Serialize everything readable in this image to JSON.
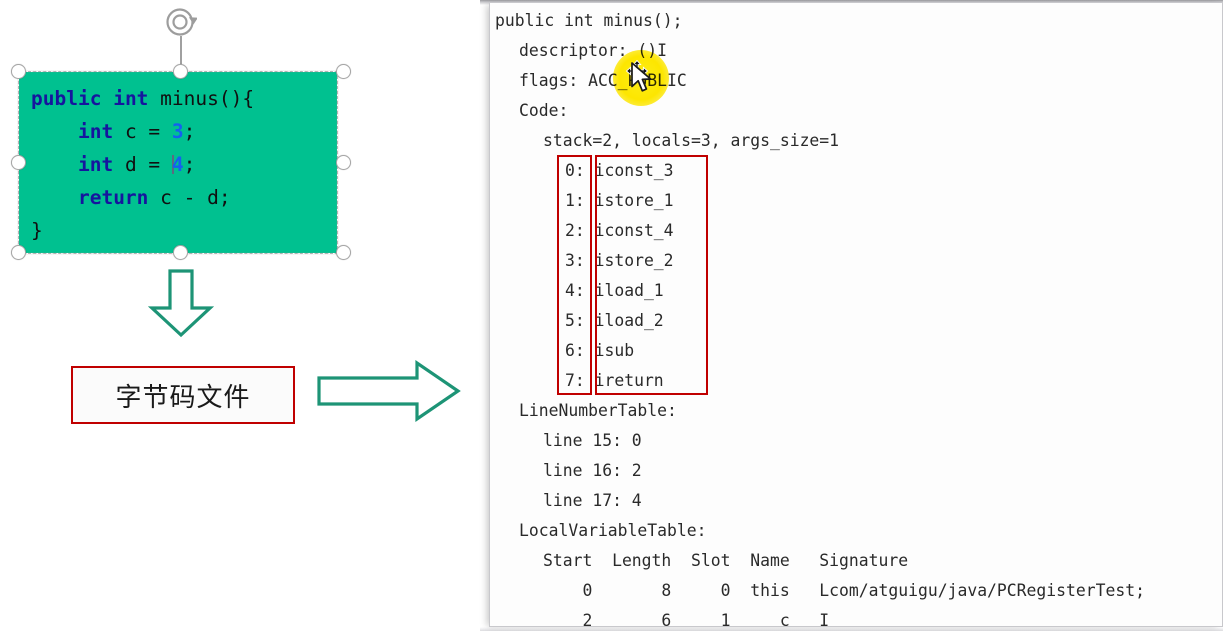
{
  "slide": {
    "code_shape": {
      "name": "java-source-snippet",
      "fill_color": "#00c190",
      "lines": [
        {
          "parts": [
            {
              "t": "public",
              "c": "kw"
            },
            {
              "t": " ",
              "c": "plain"
            },
            {
              "t": "int",
              "c": "kw"
            },
            {
              "t": " minus(){",
              "c": "plain"
            }
          ]
        },
        {
          "parts": [
            {
              "t": "    ",
              "c": "plain"
            },
            {
              "t": "int",
              "c": "kw"
            },
            {
              "t": " c = ",
              "c": "plain"
            },
            {
              "t": "3",
              "c": "num"
            },
            {
              "t": ";",
              "c": "plain"
            }
          ]
        },
        {
          "parts": [
            {
              "t": "    ",
              "c": "plain"
            },
            {
              "t": "int",
              "c": "kw"
            },
            {
              "t": " d = ",
              "c": "plain"
            },
            {
              "t": "4",
              "c": "num"
            },
            {
              "t": ";",
              "c": "plain"
            }
          ]
        },
        {
          "parts": [
            {
              "t": "    ",
              "c": "plain"
            },
            {
              "t": "return",
              "c": "kw"
            },
            {
              "t": " c - d;",
              "c": "plain"
            }
          ]
        },
        {
          "parts": [
            {
              "t": "}",
              "c": "plain"
            }
          ]
        }
      ]
    },
    "bytecode_file_box": {
      "label": "字节码文件",
      "border_color": "#c00000"
    },
    "arrows": {
      "down_arrow_name": "down-arrow",
      "right_arrow_name": "right-arrow",
      "color": "#1d9476"
    },
    "selection": {
      "rotate_handle_name": "rotate-handle",
      "handle_count": 8
    }
  },
  "bytecode_panel": {
    "lines": [
      {
        "indent": 0,
        "text": "public int minus();"
      },
      {
        "indent": 1,
        "text": "descriptor: ()I"
      },
      {
        "indent": 1,
        "text": "flags: ACC_PUBLIC"
      },
      {
        "indent": 1,
        "text": "Code:"
      },
      {
        "indent": 2,
        "text": "stack=2, locals=3, args_size=1"
      },
      {
        "indent": 3,
        "text": "0: iconst_3"
      },
      {
        "indent": 3,
        "text": "1: istore_1"
      },
      {
        "indent": 3,
        "text": "2: iconst_4"
      },
      {
        "indent": 3,
        "text": "3: istore_2"
      },
      {
        "indent": 3,
        "text": "4: iload_1"
      },
      {
        "indent": 3,
        "text": "5: iload_2"
      },
      {
        "indent": 3,
        "text": "6: isub"
      },
      {
        "indent": 3,
        "text": "7: ireturn"
      },
      {
        "indent": 1,
        "text": "LineNumberTable:"
      },
      {
        "indent": 2,
        "text": "line 15: 0"
      },
      {
        "indent": 2,
        "text": "line 16: 2"
      },
      {
        "indent": 2,
        "text": "line 17: 4"
      },
      {
        "indent": 1,
        "text": "LocalVariableTable:"
      },
      {
        "indent": 2,
        "text": "Start  Length  Slot  Name   Signature"
      },
      {
        "indent": 2,
        "text": "    0       8     0  this   Lcom/atguigu/java/PCRegisterTest;"
      },
      {
        "indent": 2,
        "text": "    2       6     1     c   I"
      }
    ],
    "highlight_boxes": [
      {
        "name": "offsets-highlight",
        "color": "#c00000"
      },
      {
        "name": "mnemonics-highlight",
        "color": "#c00000"
      }
    ],
    "click_highlight": {
      "name": "click-halo",
      "color": "#ffe800",
      "over_text": "ACC_PUBLIC"
    },
    "cursor": {
      "name": "move-cursor",
      "kind": "move"
    }
  }
}
